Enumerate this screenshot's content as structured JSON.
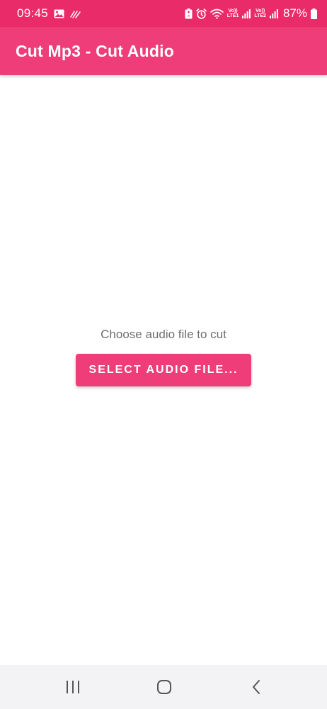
{
  "status_bar": {
    "time": "09:45",
    "sim1_label_top": "Vo))",
    "sim1_label_bottom": "LTE1",
    "sim2_label_top": "Vo))",
    "sim2_label_bottom": "LTE2",
    "battery_percent": "87%"
  },
  "app_bar": {
    "title": "Cut Mp3 - Cut Audio"
  },
  "main": {
    "prompt": "Choose audio file to cut",
    "select_button_label": "SELECT AUDIO FILE..."
  },
  "colors": {
    "status_bar": "#ea2b6a",
    "primary": "#ee3d78",
    "prompt_text": "#6e6e6e",
    "nav_bar": "#f3f3f5"
  },
  "icons": {
    "status_left": [
      "image-icon",
      "signal-wave-icon"
    ],
    "status_right": [
      "battery-saver-icon",
      "alarm-icon",
      "wifi-icon",
      "cell-signal-icon",
      "battery-icon"
    ],
    "nav": [
      "recent-apps-icon",
      "home-icon",
      "back-icon"
    ]
  }
}
